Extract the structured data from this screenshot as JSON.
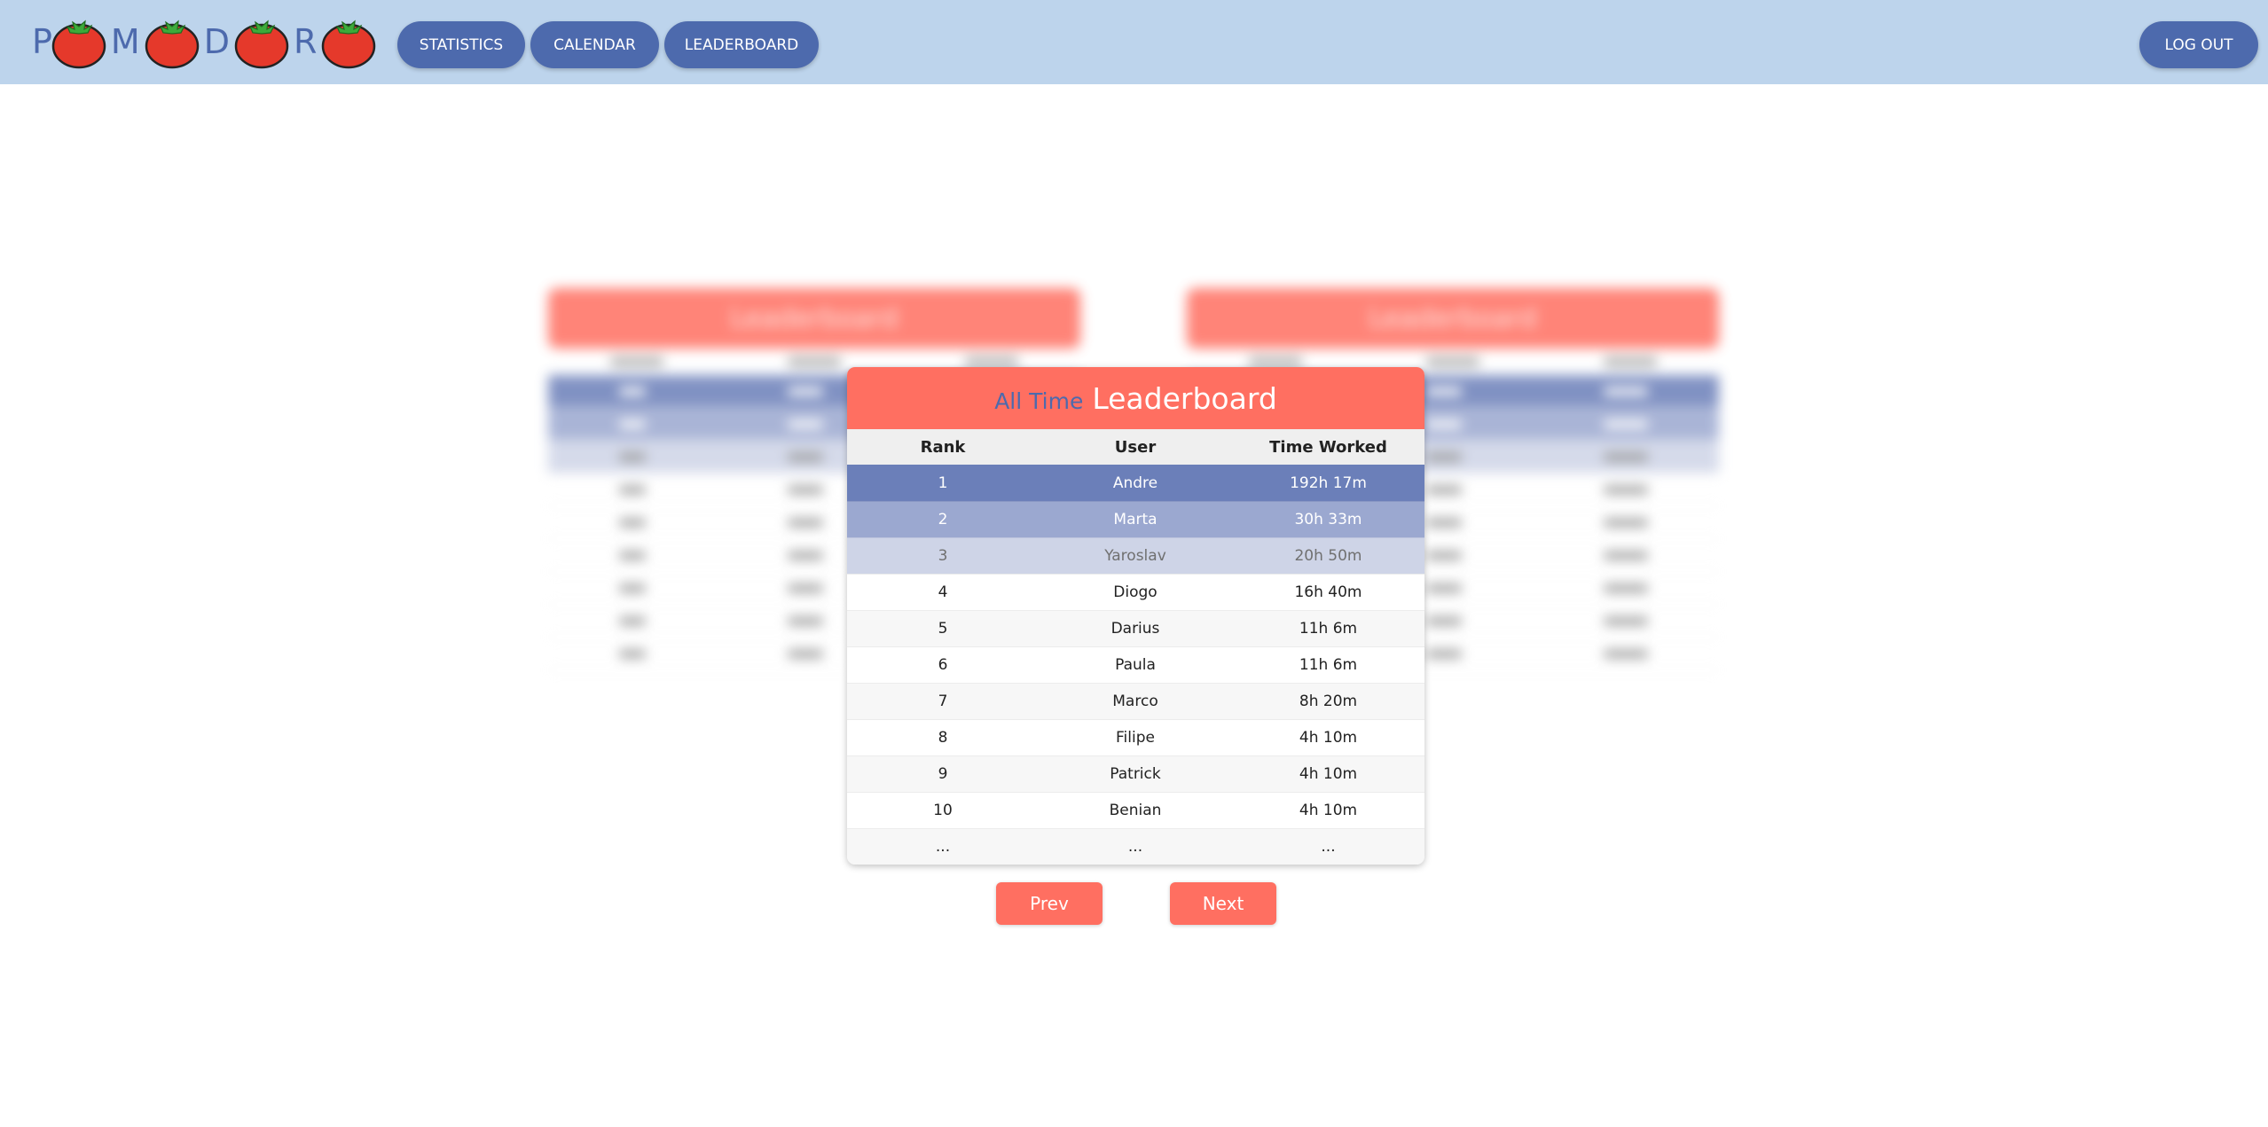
{
  "navbar": {
    "logo_letters": [
      "P",
      "M",
      "D",
      "R"
    ],
    "links": {
      "statistics": "STATISTICS",
      "calendar": "CALENDAR",
      "leaderboard": "LEADERBOARD"
    },
    "logout": "LOG OUT"
  },
  "leaderboard": {
    "period": "All Time",
    "title": "Leaderboard",
    "columns": {
      "rank": "Rank",
      "user": "User",
      "time": "Time Worked"
    },
    "rows": [
      {
        "rank": "1",
        "user": "Andre",
        "time": "192h 17m"
      },
      {
        "rank": "2",
        "user": "Marta",
        "time": "30h 33m"
      },
      {
        "rank": "3",
        "user": "Yaroslav",
        "time": "20h 50m"
      },
      {
        "rank": "4",
        "user": "Diogo",
        "time": "16h 40m"
      },
      {
        "rank": "5",
        "user": "Darius",
        "time": "11h 6m"
      },
      {
        "rank": "6",
        "user": "Paula",
        "time": "11h 6m"
      },
      {
        "rank": "7",
        "user": "Marco",
        "time": "8h 20m"
      },
      {
        "rank": "8",
        "user": "Filipe",
        "time": "4h 10m"
      },
      {
        "rank": "9",
        "user": "Patrick",
        "time": "4h 10m"
      },
      {
        "rank": "10",
        "user": "Benian",
        "time": "4h 10m"
      },
      {
        "rank": "...",
        "user": "...",
        "time": "..."
      }
    ]
  },
  "side_cards": {
    "left_title": "Leaderboard",
    "right_title": "Leaderboard"
  },
  "pager": {
    "prev": "Prev",
    "next": "Next"
  },
  "colors": {
    "navbar_bg": "#bdd4ec",
    "nav_button": "#4d6aad",
    "accent_coral": "#ff6f61",
    "rank1": "#6b7fb9",
    "rank2": "#9ba8d0",
    "rank3": "#ced4e7"
  }
}
